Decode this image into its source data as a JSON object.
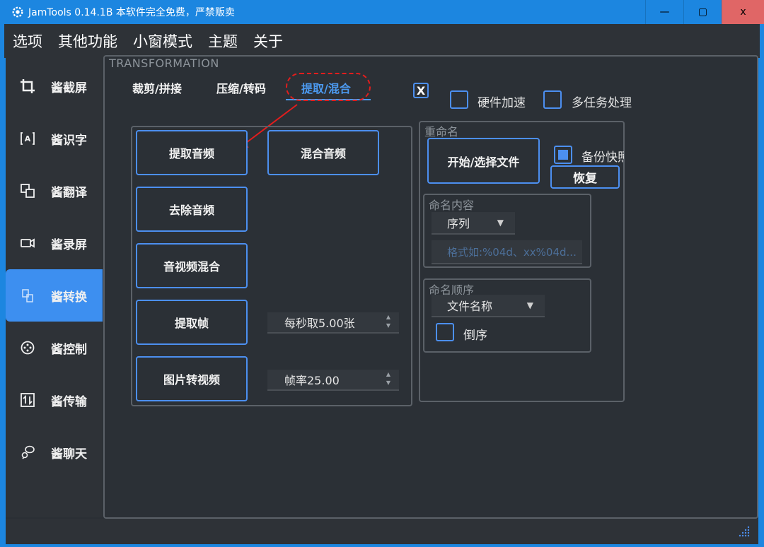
{
  "window": {
    "title": "JamTools 0.14.1B 本软件完全免费，严禁贩卖",
    "min_glyph": "—",
    "max_glyph": "▢",
    "close_glyph": "x"
  },
  "menu": [
    "选项",
    "其他功能",
    "小窗模式",
    "主题",
    "关于"
  ],
  "sidebar": {
    "items": [
      {
        "label": "酱截屏",
        "icon": "crop-icon"
      },
      {
        "label": "酱识字",
        "icon": "text-recognition-icon"
      },
      {
        "label": "酱翻译",
        "icon": "translate-icon"
      },
      {
        "label": "酱录屏",
        "icon": "video-camera-icon"
      },
      {
        "label": "酱转换",
        "icon": "convert-file-icon",
        "active": true
      },
      {
        "label": "酱控制",
        "icon": "control-icon"
      },
      {
        "label": "酱传输",
        "icon": "transfer-icon"
      },
      {
        "label": "酱聊天",
        "icon": "chat-icon"
      }
    ]
  },
  "panel": {
    "section_title": "TRANSFORMATION",
    "tabs": [
      "裁剪/拼接",
      "压缩/转码",
      "提取/混合"
    ],
    "active_tab": 2,
    "close_check_glyph": "X",
    "hw_accel_label": "硬件加速",
    "multitask_label": "多任务处理",
    "audio": {
      "extract_audio": "提取音频",
      "mix_audio": "混合音频",
      "remove_audio": "去除音频",
      "av_mix": "音视频混合",
      "extract_frames": "提取帧",
      "fps_spin": "每秒取5.00张",
      "img_to_video": "图片转视频",
      "framerate_spin": "帧率25.00"
    },
    "rename": {
      "title": "重命名",
      "start_button": "开始/选择文件",
      "backup_label": "备份快照",
      "restore_button": "恢复",
      "content": {
        "title": "命名内容",
        "select_value": "序列",
        "placeholder": "格式如:%04d、xx%04d..."
      },
      "order": {
        "title": "命名顺序",
        "select_value": "文件名称",
        "reverse_label": "倒序"
      }
    }
  },
  "colors": {
    "accent": "#4c8ff0",
    "titlebar": "#1c86e0",
    "annotation_red": "#e21d1d"
  }
}
